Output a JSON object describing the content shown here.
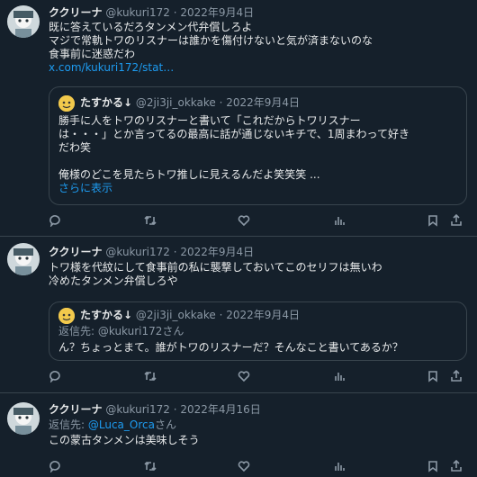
{
  "tweets": [
    {
      "name": "ククリーナ",
      "handle": "@kukuri172",
      "date": "2022年9月4日",
      "text_lines": [
        "既に答えているだろタンメン代弁償しろよ",
        "マジで常軌トワのリスナーは誰かを傷付けないと気が済まないのな",
        "食事前に迷惑だわ"
      ],
      "link": "x.com/kukuri172/stat…",
      "quote": {
        "name": "たすかる↓",
        "handle": "@2ji3ji_okkake",
        "date": "2022年9月4日",
        "text_lines": [
          "勝手に人をトワのリスナーと書いて「これだからトワリスナー",
          "は・・・」とか言ってるの最高に話が通じないキチで、1周まわって好き",
          "だわ笑",
          "",
          "俺様のどこを見たらトワ推しに見えるんだよ笑笑笑 ..."
        ],
        "more": "さらに表示"
      }
    },
    {
      "name": "ククリーナ",
      "handle": "@kukuri172",
      "date": "2022年9月4日",
      "text_lines": [
        "トワ様を代紋にして食事前の私に襲撃しておいてこのセリフは無いわ",
        "冷めたタンメン弁償しろや"
      ],
      "quote": {
        "name": "たすかる↓",
        "handle": "@2ji3ji_okkake",
        "date": "2022年9月4日",
        "reply_label": "返信先:",
        "reply_to": "@kukuri172さん",
        "text_lines": [
          "ん？ちょっとまて。誰がトワのリスナーだ？そんなこと書いてあるか？"
        ]
      }
    },
    {
      "name": "ククリーナ",
      "handle": "@kukuri172",
      "date": "2022年4月16日",
      "reply_label": "返信先:",
      "reply_to": "@Luca_Orca",
      "reply_suffix": "さん",
      "text_lines": [
        "この蒙古タンメンは美味しそう"
      ]
    }
  ],
  "separator": " · ",
  "icons": [
    "reply-icon",
    "retweet-icon",
    "like-icon",
    "views-icon",
    "bookmark-icon",
    "share-icon"
  ],
  "colors": {
    "background": "#15202b",
    "text": "#e7e9ea",
    "muted": "#8b98a5",
    "link": "#1d9bf0",
    "border": "#38444d"
  }
}
